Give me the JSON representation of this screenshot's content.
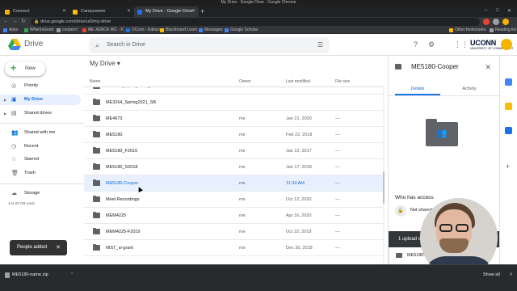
{
  "window": {
    "title": "My Drive - Google Drive - Google Chrome"
  },
  "tabs": [
    {
      "label": "Connect",
      "color": "#f4b400",
      "active": false
    },
    {
      "label": "Campuswire",
      "color": "#fbbc04",
      "active": false
    },
    {
      "label": "My Drive - Google Drive",
      "color": "#1a73e8",
      "active": true
    }
  ],
  "address": {
    "url": "drive.google.com/drive/u/0/my-drive"
  },
  "bookmarks": [
    {
      "label": "Apps",
      "color": "#4285f4"
    },
    {
      "label": "WhenIsGood",
      "color": "#34a853"
    },
    {
      "label": "cooperrc",
      "color": "#9aa0a6"
    },
    {
      "label": "ME XEROX WC - P...",
      "color": "#ea4335"
    },
    {
      "label": "UConn - Kaltura",
      "color": "#1a73e8"
    },
    {
      "label": "Blackboard Learn",
      "color": "#fbbc04"
    },
    {
      "label": "Messages",
      "color": "#4285f4"
    },
    {
      "label": "Google Scholar",
      "color": "#4285f4"
    },
    {
      "label": "Other bookmarks",
      "color": "#fbbc04"
    },
    {
      "label": "Reading list",
      "color": "#9aa0a6"
    }
  ],
  "drive": {
    "title": "Drive",
    "search_placeholder": "Search in Drive",
    "org_logo": "UCONN",
    "org_sub": "UNIVERSITY OF CONNECTICUT"
  },
  "sidebar": {
    "new_label": "New",
    "items": [
      {
        "label": "Priority",
        "icon": "check-circle-icon",
        "active": false
      },
      {
        "label": "My Drive",
        "icon": "drive-icon",
        "active": true
      },
      {
        "label": "Shared drives",
        "icon": "shared-drives-icon",
        "active": false
      },
      {
        "label": "Shared with me",
        "icon": "people-icon",
        "active": false
      },
      {
        "label": "Recent",
        "icon": "clock-icon",
        "active": false
      },
      {
        "label": "Starred",
        "icon": "star-icon",
        "active": false
      },
      {
        "label": "Trash",
        "icon": "trash-icon",
        "active": false
      }
    ],
    "storage_label": "Storage",
    "storage_used": "144.63 GB used",
    "storage_fraction": 0.3
  },
  "main": {
    "breadcrumb": "My Drive",
    "columns": {
      "name": "Name",
      "owner": "Owner",
      "modified": "Last modified",
      "size": "File size"
    },
    "rows": [
      {
        "name": "ME3264_Spring2021_SB",
        "owner": "",
        "modified": "",
        "size": "",
        "selected": false,
        "partial": true
      },
      {
        "name": "ME4973",
        "owner": "me",
        "modified": "Jan 21, 2020",
        "size": "—",
        "selected": false
      },
      {
        "name": "ME5180",
        "owner": "me",
        "modified": "Feb 22, 2018",
        "size": "—",
        "selected": false
      },
      {
        "name": "ME5180_F2016",
        "owner": "me",
        "modified": "Jan 12, 2017",
        "size": "—",
        "selected": false
      },
      {
        "name": "ME5180_S2018",
        "owner": "me",
        "modified": "Jan 17, 2018",
        "size": "—",
        "selected": false
      },
      {
        "name": "ME5180-Cooper",
        "owner": "me",
        "modified": "11:34 AM",
        "size": "—",
        "selected": true
      },
      {
        "name": "Meet Recordings",
        "owner": "me",
        "modified": "Oct 12, 2020",
        "size": "—",
        "selected": false
      },
      {
        "name": "MEM4225",
        "owner": "me",
        "modified": "Apr 16, 2020",
        "size": "—",
        "selected": false
      },
      {
        "name": "MEM4225-F2019",
        "owner": "me",
        "modified": "Oct 22, 2019",
        "size": "—",
        "selected": false
      },
      {
        "name": "NIST_si-grant",
        "owner": "me",
        "modified": "Dec 30, 2018",
        "size": "—",
        "selected": false
      }
    ]
  },
  "details": {
    "title": "ME5180-Cooper",
    "tab_details": "Details",
    "tab_activity": "Activity",
    "who_has_access": "Who has access",
    "access_status": "Not shared",
    "upload_title": "1 upload complete",
    "upload_item": "ME5180"
  },
  "snackbar": {
    "text": "People added"
  },
  "download": {
    "file": "ME5180-name.zip",
    "show_all": "Show all"
  }
}
